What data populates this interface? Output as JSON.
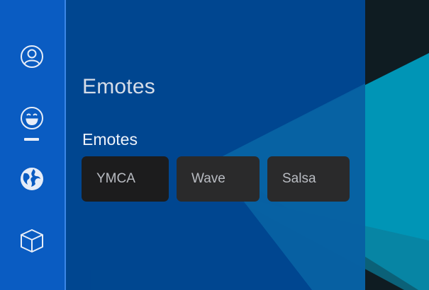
{
  "panel": {
    "title": "Emotes",
    "section_title": "Emotes"
  },
  "sidebar": {
    "items": [
      {
        "icon": "profile-icon"
      },
      {
        "icon": "smiley-icon",
        "active": true
      },
      {
        "icon": "globe-icon"
      },
      {
        "icon": "cube-icon"
      }
    ]
  },
  "emotes": [
    {
      "label": "YMCA",
      "selected": true
    },
    {
      "label": "Wave",
      "selected": false
    },
    {
      "label": "Salsa",
      "selected": false
    }
  ],
  "colors": {
    "sidebar": "#0a5cc2",
    "panel": "#004894",
    "accent_cyan": "#0096b4",
    "card": "#2a2a2b"
  }
}
